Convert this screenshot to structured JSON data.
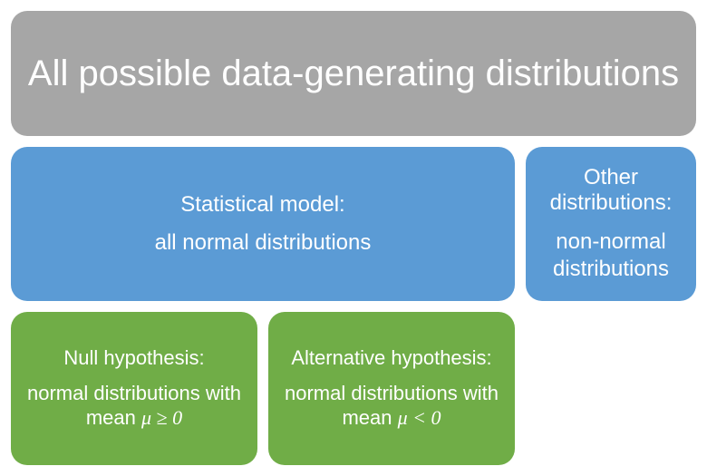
{
  "top": {
    "title": "All possible data-generating distributions"
  },
  "model": {
    "title": "Statistical model:",
    "sub": "all normal distributions"
  },
  "other": {
    "title": "Other distributions:",
    "sub": "non-normal distributions"
  },
  "null_hyp": {
    "title": "Null hypothesis:",
    "sub_prefix": "normal distributions with mean ",
    "sub_math": "μ ≥ 0"
  },
  "alt_hyp": {
    "title": "Alternative hypothesis:",
    "sub_prefix": "normal distributions with mean ",
    "sub_math": "μ < 0"
  },
  "colors": {
    "gray": "#a6a6a6",
    "blue": "#5b9bd5",
    "green": "#70ad47"
  }
}
